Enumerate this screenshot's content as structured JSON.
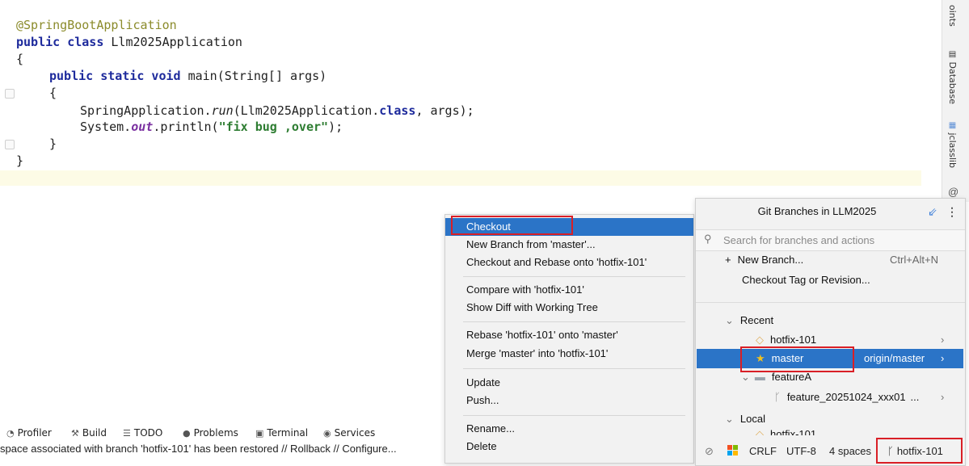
{
  "editor": {
    "annotation": "@SpringBootApplication",
    "class_kw": "public class ",
    "class_name": "Llm2025Application",
    "open_brace_1": "{",
    "main_kw": "public static void ",
    "main_sig": "main(String[] args)",
    "open_brace_2": "{",
    "run_pre": "SpringApplication.",
    "run_method": "run",
    "run_mid": "(Llm2025Application.",
    "run_class_kw": "class",
    "run_post": ", args);",
    "print_pre": "System.",
    "print_out": "out",
    "print_mid": ".println(",
    "print_str": "\"fix bug ,over\"",
    "print_post": ");",
    "close_brace_2": "}",
    "close_brace_1": "}"
  },
  "right_strip": {
    "points_label": "oints",
    "database_label": "Database",
    "jclasslib_label": "jclasslib",
    "at_icon": "@"
  },
  "tool_windows": [
    {
      "icon": "profiler-icon",
      "label": "Profiler"
    },
    {
      "icon": "build-icon",
      "label": "Build"
    },
    {
      "icon": "todo-icon",
      "label": "TODO"
    },
    {
      "icon": "problems-icon",
      "label": "Problems"
    },
    {
      "icon": "terminal-icon",
      "label": "Terminal"
    },
    {
      "icon": "services-icon",
      "label": "Services"
    }
  ],
  "status_message": "space associated with branch 'hotfix-101' has been restored // Rollback // Configure...",
  "context_menu": {
    "items": [
      {
        "label": "Checkout",
        "selected": true
      },
      {
        "label": "New Branch from 'master'..."
      },
      {
        "label": "Checkout and Rebase onto 'hotfix-101'"
      },
      {
        "label": "Compare with 'hotfix-101'"
      },
      {
        "label": "Show Diff with Working Tree"
      },
      {
        "label": "Rebase 'hotfix-101' onto 'master'"
      },
      {
        "label": "Merge 'master' into 'hotfix-101'"
      },
      {
        "label": "Update"
      },
      {
        "label": "Push..."
      },
      {
        "label": "Rename..."
      },
      {
        "label": "Delete"
      }
    ]
  },
  "git_popup": {
    "title": "Git Branches in LLM2025",
    "search_placeholder": "Search for branches and actions",
    "new_branch": "New Branch...",
    "new_branch_shortcut": "Ctrl+Alt+N",
    "checkout_tag": "Checkout Tag or Revision...",
    "recent_label": "Recent",
    "recent_branches": [
      "hotfix-101",
      "master"
    ],
    "master_tracking": "origin/master",
    "folder_name": "featureA",
    "feature_branch": "feature_20251024_xxx01",
    "feature_ellipsis": "...",
    "local_label": "Local",
    "local_partial": "hotfix-101"
  },
  "status_bar": {
    "line_sep": "CRLF",
    "encoding": "UTF-8",
    "indent": "4 spaces",
    "branch": "hotfix-101"
  },
  "colors": {
    "selection": "#2b74c7",
    "highlight_box": "#d91f26",
    "current_line": "#fdfbe6"
  }
}
